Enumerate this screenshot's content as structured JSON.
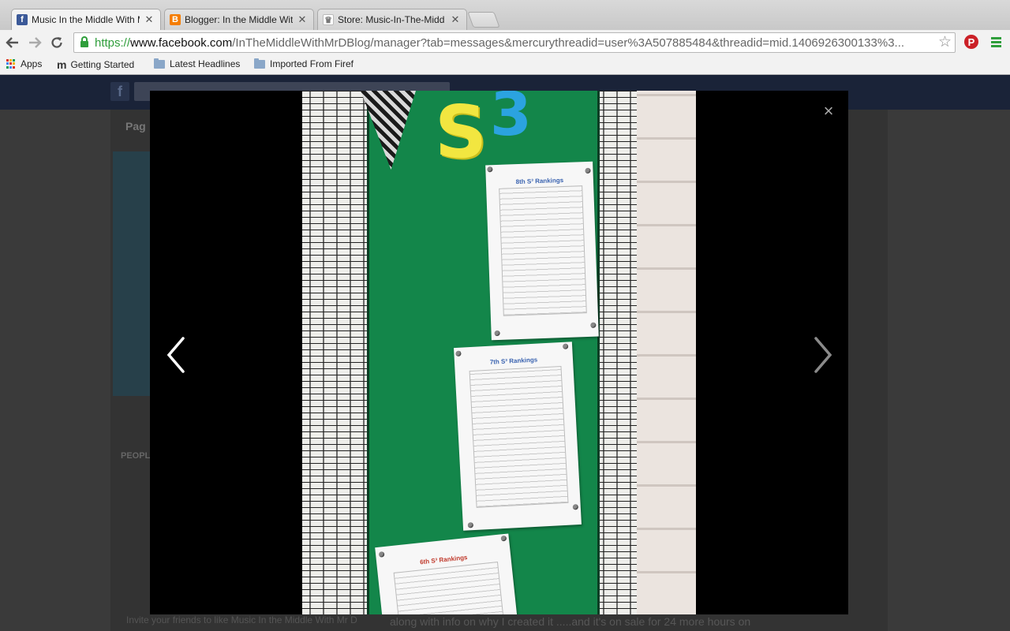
{
  "browser": {
    "tabs": [
      {
        "title": "Music In the Middle With M",
        "favicon": "facebook-icon"
      },
      {
        "title": "Blogger: In the Middle With",
        "favicon": "blogger-icon"
      },
      {
        "title": "Store: Music-In-The-Midd",
        "favicon": "store-icon"
      }
    ],
    "url": {
      "scheme": "https://",
      "host": "www.facebook.com",
      "path": "/InTheMiddleWithMrDBlog/manager?tab=messages&mercurythreadid=user%3A507885484&threadid=mid.1406926300133%3..."
    },
    "bookmarks": [
      {
        "label": "Apps",
        "icon": "apps-grid-icon"
      },
      {
        "label": "Getting Started",
        "icon": "m-icon"
      },
      {
        "label": "Latest Headlines",
        "icon": "folder-icon"
      },
      {
        "label": "Imported From Firef",
        "icon": "folder-icon"
      }
    ]
  },
  "page": {
    "tab_label": "Pag",
    "people_label": "PEOPL",
    "invite_text": "Invite your friends to like Music In the Middle With Mr D",
    "post_text": "along with info on why I created it .....and it's on sale for 24 more hours on"
  },
  "viewer": {
    "close_label": "×",
    "photo": {
      "letters": {
        "s": "S",
        "superscript": "3"
      },
      "sheets": [
        {
          "title": "8th S³ Rankings"
        },
        {
          "title": "7th S³ Rankings"
        },
        {
          "title": "6th S³ Rankings"
        }
      ]
    }
  },
  "colors": {
    "felt": "#13864a",
    "letter_s": "#f2e640",
    "letter_3": "#2ba3e0",
    "chrome_green": "#2f9e3b"
  }
}
